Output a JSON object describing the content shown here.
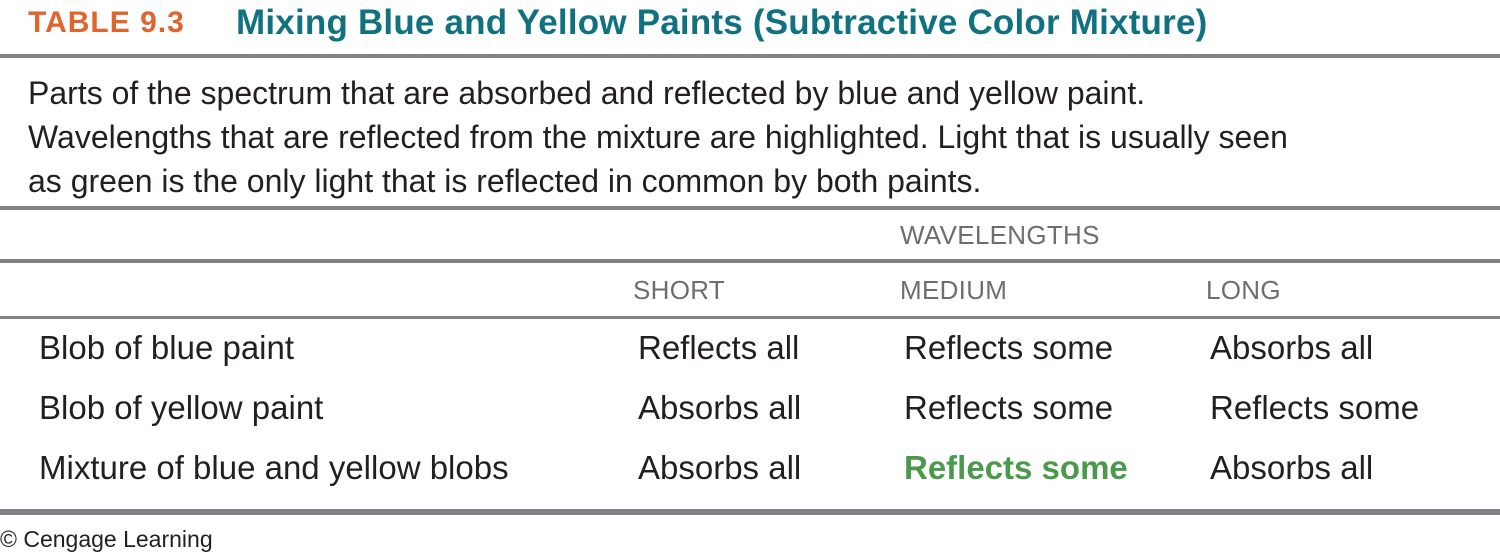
{
  "table": {
    "label": "TABLE 9.3",
    "title": "Mixing Blue and Yellow Paints (Subtractive Color Mixture)",
    "caption_lines": [
      "Parts of the spectrum that are absorbed and reflected by blue and yellow paint.",
      "Wavelengths that are reflected from the mixture are highlighted. Light that is usually seen",
      "as green is the only light that is reflected in common by both paints."
    ],
    "group_header": "WAVELENGTHS",
    "columns": [
      "SHORT",
      "MEDIUM",
      "LONG"
    ],
    "rows": [
      {
        "label": "Blob of blue paint",
        "cells": [
          "Reflects all",
          "Reflects some",
          "Absorbs all"
        ]
      },
      {
        "label": "Blob of yellow paint",
        "cells": [
          "Absorbs all",
          "Reflects some",
          "Reflects some"
        ]
      },
      {
        "label": "Mixture of blue and yellow blobs",
        "cells": [
          "Absorbs all",
          "Reflects some",
          "Absorbs all"
        ]
      }
    ],
    "highlight_color": "#4b9a4c",
    "label_color": "#e0642e",
    "title_color": "#11727f"
  },
  "credit": "© Cengage Learning"
}
